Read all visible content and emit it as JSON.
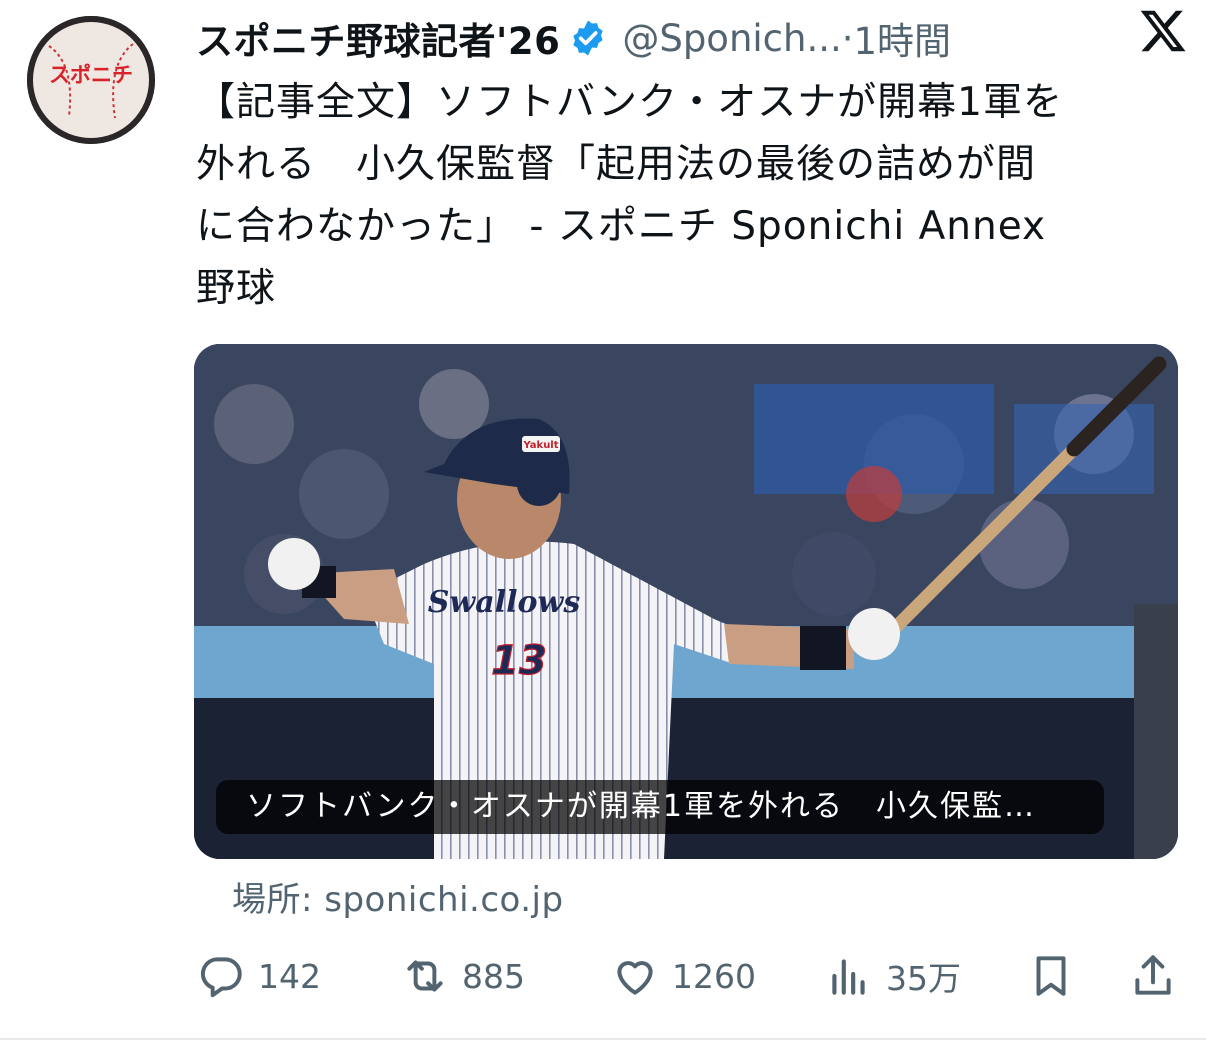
{
  "author": {
    "name": "スポニチ野球記者'26",
    "handle": "@Sponich...",
    "time_sep": "·",
    "time": "1時間",
    "avatar_text": "スポニチ"
  },
  "tweet": {
    "text": "【記事全文】ソフトバンク・オスナが開幕1軍を\n外れる　小久保監督「起用法の最後の詰めが間\nに合わなかった」 - スポニチ Sponichi Annex\n野球"
  },
  "card": {
    "title": "ソフトバンク・オスナが開幕1軍を外れる　小久保監…",
    "jersey_text": "Swallows",
    "jersey_number": "13",
    "helmet_text": "Yakult",
    "source": "場所: sponichi.co.jp"
  },
  "actions": {
    "replies": "142",
    "reposts": "885",
    "likes": "1260",
    "views": "35万"
  },
  "colors": {
    "accent": "#1d9bf0",
    "text_primary": "#0f1419",
    "text_secondary": "#536471"
  },
  "icons": [
    "verified-badge-icon",
    "x-logo-icon",
    "reply-icon",
    "repost-icon",
    "like-icon",
    "views-icon",
    "bookmark-icon",
    "share-icon"
  ]
}
